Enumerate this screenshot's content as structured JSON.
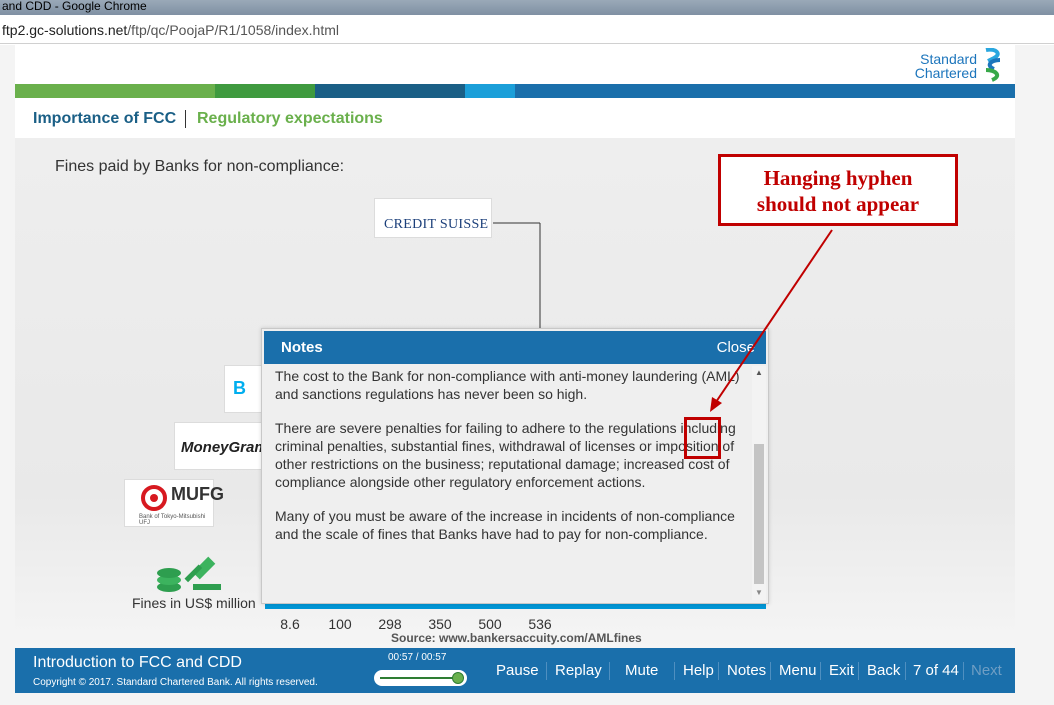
{
  "browser": {
    "window_title": "and CDD - Google Chrome",
    "url_host": "ftp2.gc-solutions.net",
    "url_path": "/ftp/qc/PoojaP/R1/1058/index.html"
  },
  "brand": {
    "logo_line1": "Standard",
    "logo_line2": "Chartered"
  },
  "breadcrumb": {
    "first": "Importance of FCC",
    "second": "Regulatory expectations"
  },
  "slide": {
    "heading": "Fines paid by Banks for non-compliance:",
    "logos": {
      "credit_suisse": "CREDIT SUISSE",
      "barclays": "B",
      "moneygram": "MoneyGram",
      "mufg": "MUFG",
      "mufg_sub": "Bank of Tokyo-Mitsubishi UFJ"
    },
    "axis_label": "Fines in US$ million",
    "source": "Source: www.bankersaccuity.com/AMLfines"
  },
  "chart_data": {
    "type": "bar",
    "categories": [
      "8.6",
      "100",
      "298",
      "350",
      "500",
      "536"
    ],
    "values": [
      8.6,
      100,
      298,
      350,
      500,
      536
    ],
    "xlabel": "Fines in US$ million",
    "colors": [
      "#0096d6"
    ]
  },
  "notes": {
    "title": "Notes",
    "close": "Close",
    "paragraphs": [
      "The cost to the Bank for non-compliance with anti-money laundering (AML) and sanctions regulations has never been so high.",
      "There are severe penalties for failing to adhere to the regulations including criminal penalties, substantial fines, withdrawal of licenses or imposition of other restrictions on the business; reputational damage; increased cost of compliance alongside other regulatory enforcement actions.",
      "Many of you must be aware of the increase in incidents of non-compliance and the scale of fines that Banks have had to pay for non-compliance."
    ]
  },
  "footer": {
    "course_title": "Introduction to FCC and CDD",
    "copyright": "Copyright © 2017. Standard Chartered Bank. All rights reserved.",
    "time": "00:57 / 00:57",
    "progress_fraction": 1.0,
    "controls": {
      "pause": "Pause",
      "replay": "Replay",
      "mute": "Mute",
      "help": "Help",
      "notes": "Notes",
      "menu": "Menu",
      "exit": "Exit",
      "back": "Back",
      "page": "7 of 44",
      "next": "Next"
    }
  },
  "annotation": {
    "callout_line1": "Hanging hyphen",
    "callout_line2": "should not appear",
    "color": "#c00000"
  }
}
